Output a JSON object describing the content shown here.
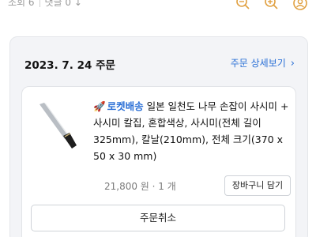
{
  "header": {
    "views_label": "조회 6",
    "comments_label": "댓글 0",
    "comments_arrow": "↓",
    "icons": [
      "search-minus-icon",
      "search-plus-icon",
      "user-circle-icon"
    ],
    "accent_color": "#e0a040"
  },
  "order": {
    "date": "2023. 7. 24 주문",
    "detail_link": "주문 상세보기",
    "detail_chevron": "›",
    "link_color": "#2a6fd6"
  },
  "item": {
    "delivery_badge": "로켓배송",
    "title": "일본 일천도 나무 손잡이 사시미 + 사시미 칼집, 혼합색상, 사시미(전체 길이 325mm), 칼날(210mm), 전체 크기(370 x 50 x 30 mm)",
    "price_qty": "21,800 원 · 1 개",
    "cart_button": "장바구니 담기",
    "image_icon": "knife-product-image"
  },
  "actions": {
    "cancel_button": "주문취소"
  }
}
